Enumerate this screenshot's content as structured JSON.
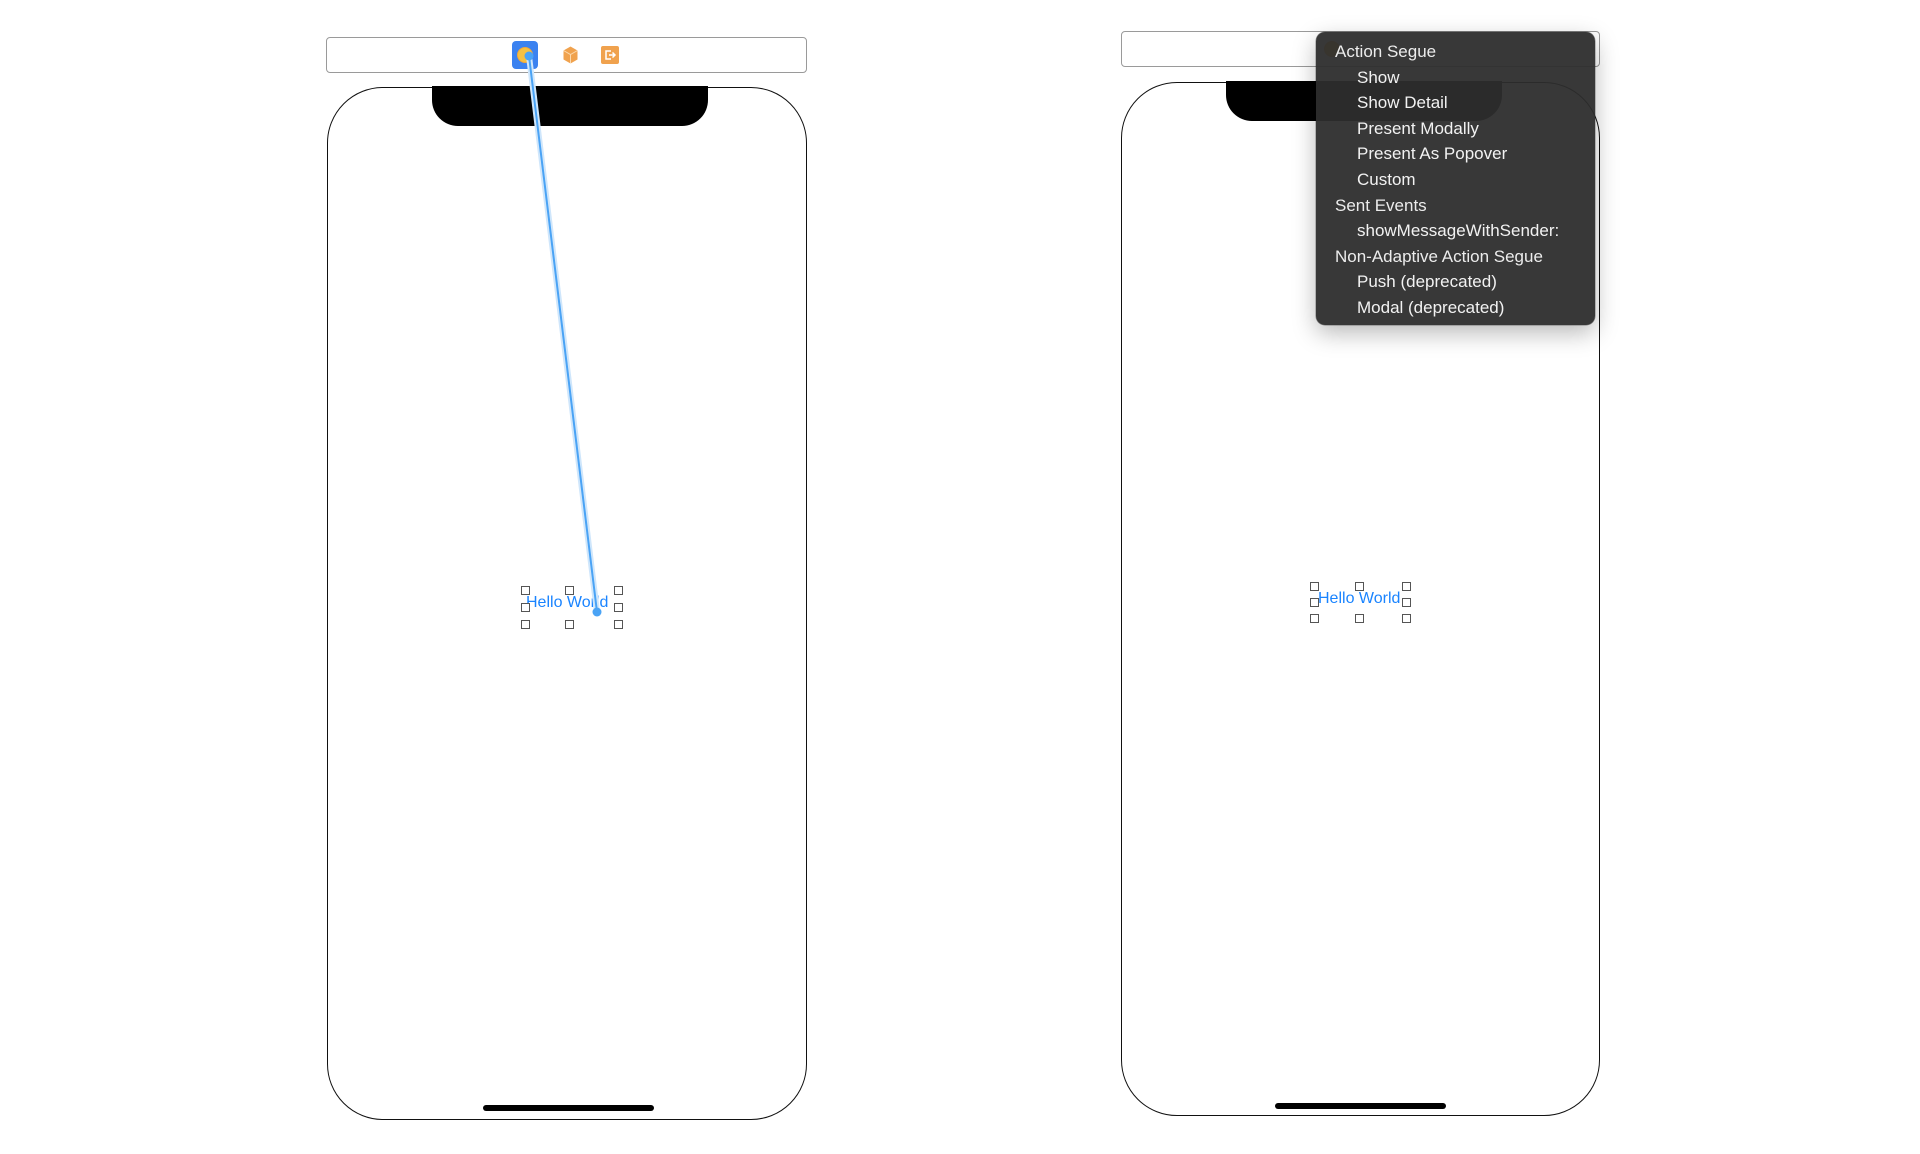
{
  "scenes": [
    {
      "name": "left-scene",
      "dock_icons": [
        "view-controller-icon",
        "first-responder-icon",
        "exit-icon"
      ],
      "label_text": "Hello World",
      "connection_drag": true
    },
    {
      "name": "right-scene",
      "dock_icons": [
        "view-controller-icon"
      ],
      "label_text": "Hello World"
    }
  ],
  "segue_menu": {
    "sections": [
      {
        "header": "Action Segue",
        "items": [
          "Show",
          "Show Detail",
          "Present Modally",
          "Present As Popover",
          "Custom"
        ]
      },
      {
        "header": "Sent Events",
        "items": [
          "showMessageWithSender:"
        ]
      },
      {
        "header": "Non-Adaptive Action Segue",
        "items": [
          "Push (deprecated)",
          "Modal (deprecated)"
        ]
      }
    ]
  },
  "colors": {
    "selection_blue": "#3b82f0",
    "connection_line": "#4aa3f5",
    "label_blue": "#1a84ff",
    "object_orange": "#f0a24e",
    "menu_bg": "#2d2d2d"
  }
}
